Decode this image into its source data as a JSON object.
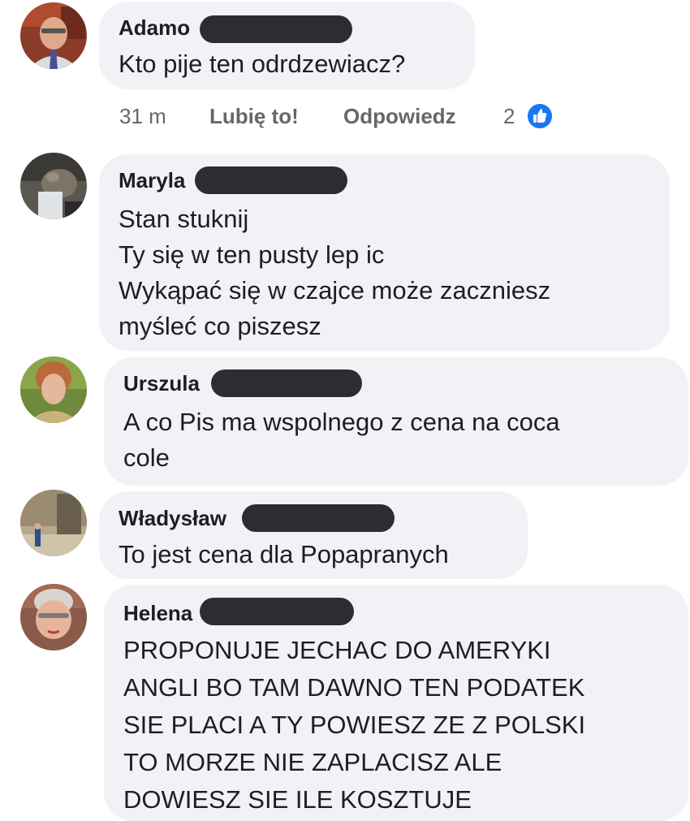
{
  "comments": [
    {
      "name": "Adamo",
      "lines": [
        "Kto pije ten odrdzewiacz?"
      ],
      "meta": {
        "time": "31 m",
        "like_label": "Lubię to!",
        "reply_label": "Odpowiedz",
        "reaction_count": "2"
      }
    },
    {
      "name": "Maryla",
      "lines": [
        "Stan stuknij",
        "Ty się w ten pusty lep ic",
        "Wykąpać się w czajce może zaczniesz",
        "myśleć co piszesz"
      ]
    },
    {
      "name": "Urszula",
      "lines": [
        "A co Pis ma wspolnego z cena na coca",
        "cole"
      ]
    },
    {
      "name": "Władysław",
      "lines": [
        "To jest cena dla Popapranych"
      ]
    },
    {
      "name": "Helena",
      "lines": [
        "PROPONUJE JECHAC DO AMERYKI",
        "ANGLI BO TAM DAWNO TEN PODATEK",
        "SIE PLACI A TY POWIESZ ZE Z POLSKI",
        "TO MORZE NIE ZAPLACISZ ALE",
        "DOWIESZ SIE ILE KOSZTUJE"
      ]
    }
  ],
  "colors": {
    "bubble": "#f0f2f5",
    "redaction": "#2b2d31",
    "like_blue": "#1877f2",
    "meta_gray": "#65676b"
  }
}
